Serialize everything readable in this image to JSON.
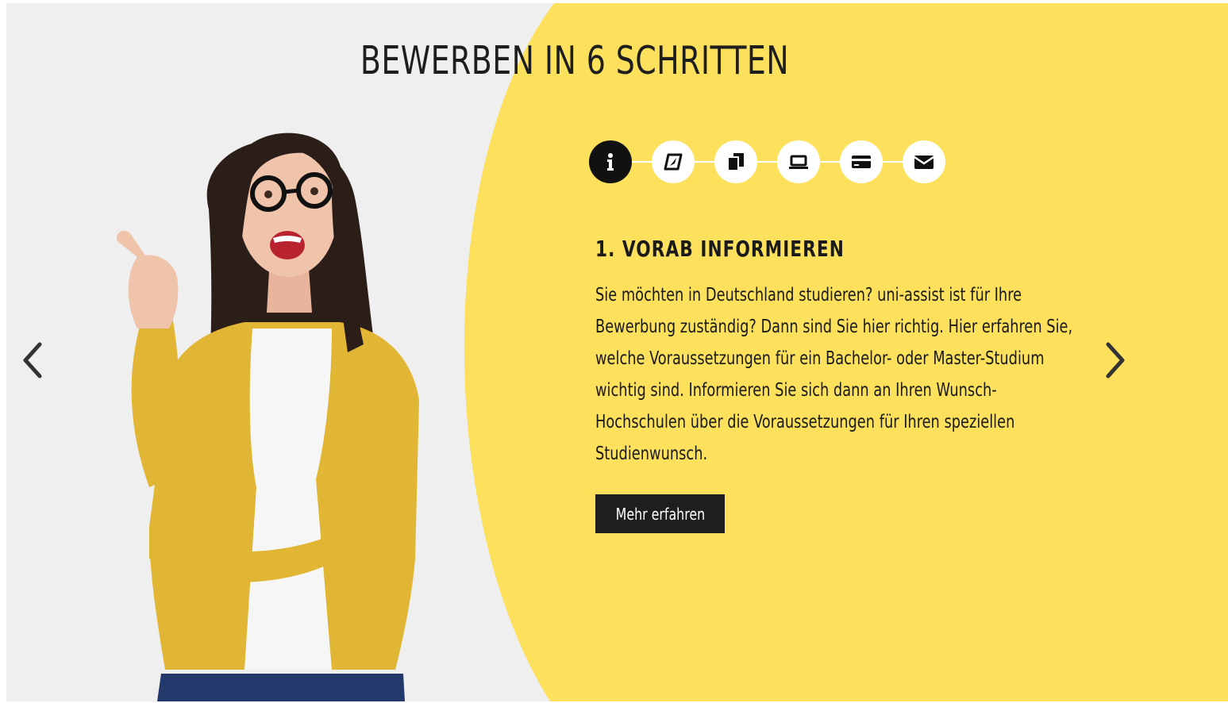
{
  "section": {
    "title": "BEWERBEN IN 6 SCHRITTEN"
  },
  "colors": {
    "background": "#efefef",
    "accent_yellow": "#fde05c",
    "dark": "#111111",
    "button_bg": "#1e1e1e"
  },
  "steps": [
    {
      "icon": "info-icon",
      "active": true
    },
    {
      "icon": "compass-icon",
      "active": false
    },
    {
      "icon": "documents-icon",
      "active": false
    },
    {
      "icon": "laptop-icon",
      "active": false
    },
    {
      "icon": "credit-card-icon",
      "active": false
    },
    {
      "icon": "envelope-icon",
      "active": false
    }
  ],
  "current_step": {
    "heading": "1. VORAB INFORMIEREN",
    "text": "Sie möchten in Deutschland studieren? uni-assist ist für Ihre Bewerbung zuständig? Dann sind Sie hier richtig. Hier erfahren Sie, welche Voraussetzungen für ein Bachelor- oder Master-Studium wichtig sind. Informieren Sie sich dann an Ihren Wunsch-Hochschulen über die Voraussetzungen für Ihren speziellen Studienwunsch.",
    "button_label": "Mehr erfahren"
  },
  "navigation": {
    "prev_icon": "chevron-left-icon",
    "next_icon": "chevron-right-icon"
  }
}
